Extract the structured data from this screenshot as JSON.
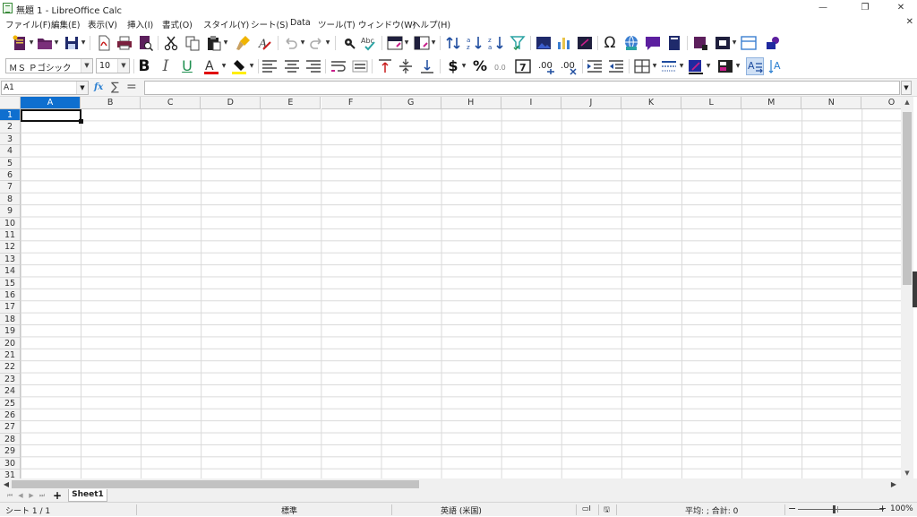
{
  "window": {
    "title": "無題 1 - LibreOffice Calc",
    "minimize": "—",
    "restore": "❐",
    "close": "✕"
  },
  "menu": {
    "items": [
      "ファイル(F)",
      "編集(E)",
      "表示(V)",
      "挿入(I)",
      "書式(O)",
      "スタイル(Y)",
      "シート(S)",
      "Data",
      "ツール(T)",
      "ウィンドウ(W)",
      "ヘルプ(H)"
    ],
    "doc_close": "✕"
  },
  "formatting": {
    "font_name": "ＭＳ Ｐゴシック",
    "font_size": "10",
    "bold": "B",
    "italic": "I",
    "underline": "U",
    "currency": "$",
    "percent": "%",
    "number_format": "7",
    "add_decimal": ".0",
    "remove_decimal": ".0"
  },
  "formula_bar": {
    "name_box": "A1",
    "function_wizard": "fx",
    "sum": "∑",
    "equals": "=",
    "content": ""
  },
  "grid": {
    "columns": [
      "A",
      "B",
      "C",
      "D",
      "E",
      "F",
      "G",
      "H",
      "I",
      "J",
      "K",
      "L",
      "M",
      "N",
      "O"
    ],
    "rows": [
      "1",
      "2",
      "3",
      "4",
      "5",
      "6",
      "7",
      "8",
      "9",
      "10",
      "11",
      "12",
      "13",
      "14",
      "15",
      "16",
      "17",
      "18",
      "19",
      "20",
      "21",
      "22",
      "23",
      "24",
      "25",
      "26",
      "27",
      "28",
      "29",
      "30",
      "31"
    ],
    "selected_cell": "A1"
  },
  "sheets": {
    "tabs": [
      "Sheet1"
    ],
    "add": "+"
  },
  "status": {
    "sheet_position": "シート 1 / 1",
    "page_style": "標準",
    "language": "英語 (米国)",
    "summary": "平均: ; 合計: 0",
    "zoom": "100%",
    "zoom_out": "−",
    "zoom_in": "+"
  },
  "colors": {
    "accent": "#0f6fcf",
    "icon_dark_blue": "#1f2a6b",
    "icon_purple": "#5c1f5c",
    "icon_red": "#c81e1e",
    "font_color_bar": "#e00000",
    "highlight_bar": "#ffee00"
  }
}
